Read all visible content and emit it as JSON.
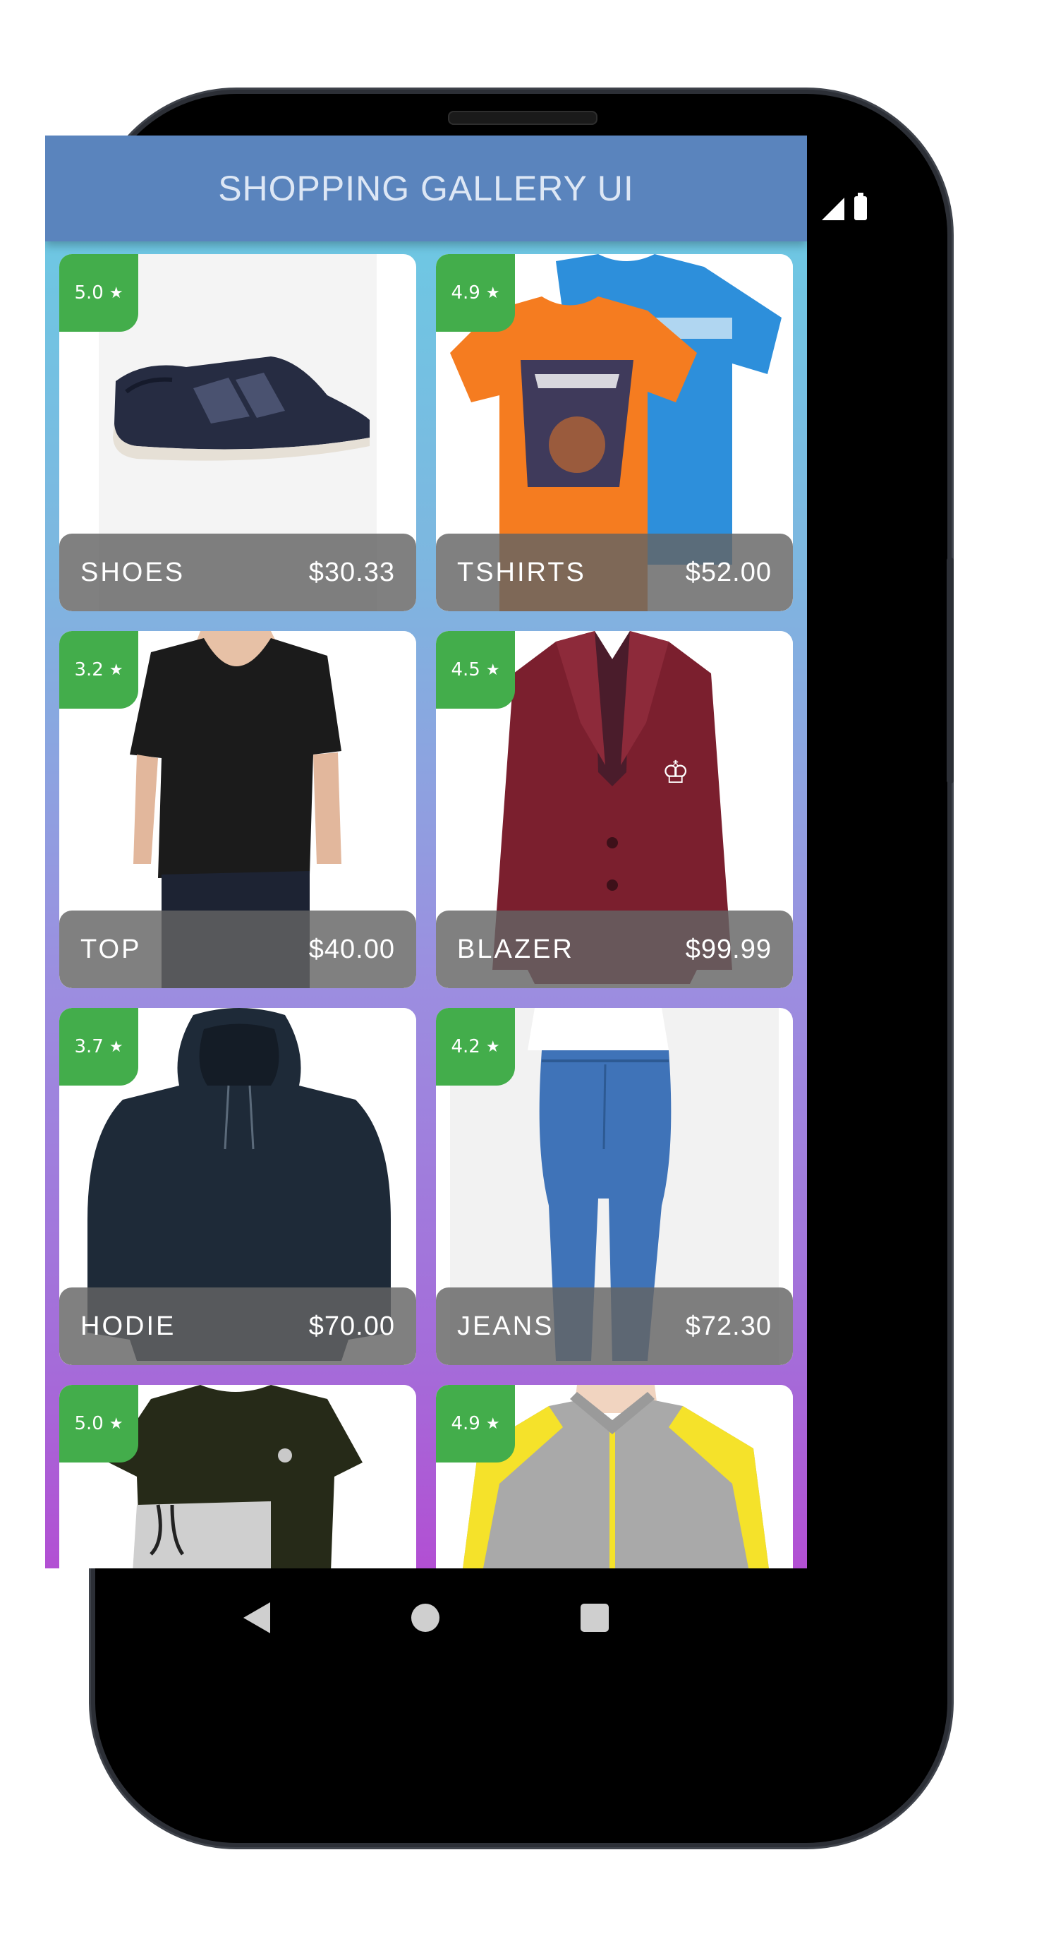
{
  "app": {
    "title": "SHOPPING GALLERY UI"
  },
  "colors": {
    "header": "#5a84bd",
    "rating_badge": "#43ad4b",
    "caption_bg": "#646464"
  },
  "products": [
    {
      "name": "SHOES",
      "price": "$30.33",
      "rating": "5.0",
      "image": "shoe-image"
    },
    {
      "name": "TSHIRTS",
      "price": "$52.00",
      "rating": "4.9",
      "image": "tshirts-image"
    },
    {
      "name": "TOP",
      "price": "$40.00",
      "rating": "3.2",
      "image": "top-image"
    },
    {
      "name": "BLAZER",
      "price": "$99.99",
      "rating": "4.5",
      "image": "blazer-image"
    },
    {
      "name": "HODIE",
      "price": "$70.00",
      "rating": "3.7",
      "image": "hoodie-image"
    },
    {
      "name": "JEANS",
      "price": "$72.30",
      "rating": "4.2",
      "image": "jeans-image"
    },
    {
      "name": "",
      "price": "",
      "rating": "5.0",
      "image": "tshirt-shorts-image"
    },
    {
      "name": "",
      "price": "",
      "rating": "4.9",
      "image": "track-jacket-image"
    }
  ],
  "icons": {
    "star": "★",
    "back": "back-icon",
    "home": "home-icon",
    "recent": "recent-apps-icon"
  }
}
